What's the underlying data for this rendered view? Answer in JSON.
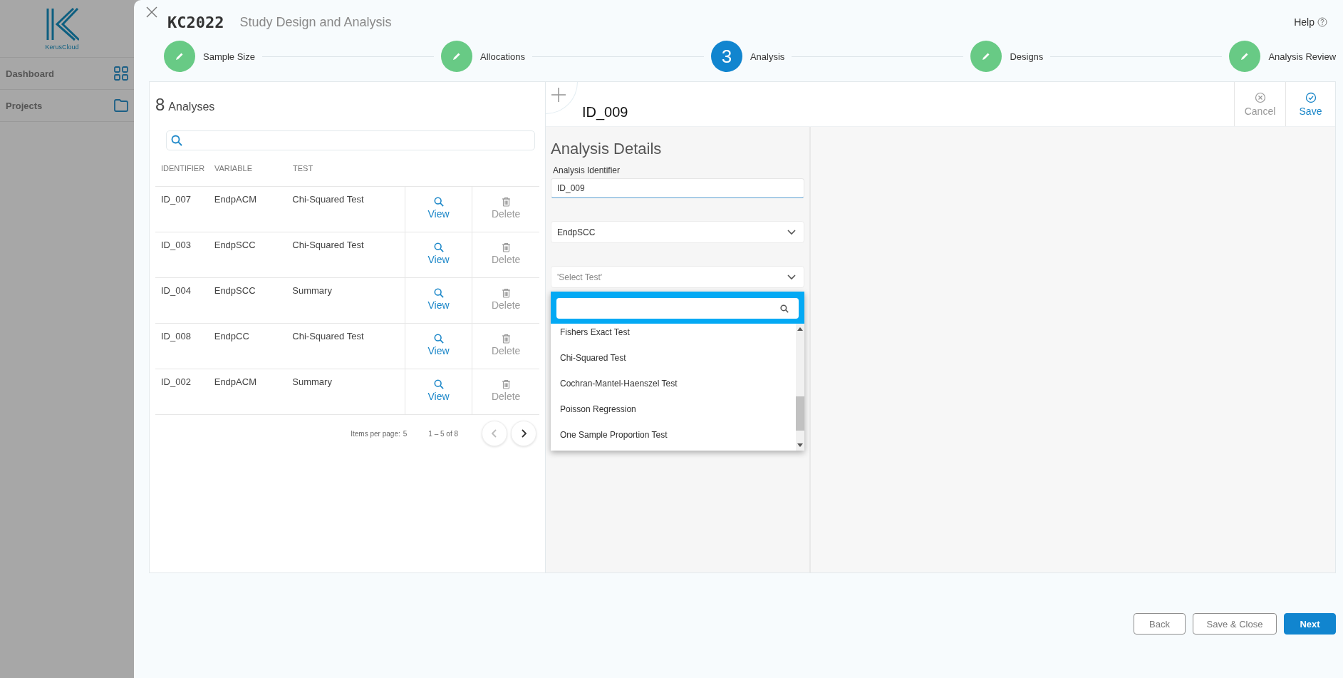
{
  "sidebar": {
    "logo_text": "KerusCloud",
    "items": [
      {
        "label": "Dashboard",
        "kind": "grid"
      },
      {
        "label": "Projects",
        "kind": "folder"
      }
    ]
  },
  "header": {
    "code": "KC2022",
    "title": "Study Design and Analysis",
    "help": "Help"
  },
  "steps": [
    {
      "label": "Sample Size",
      "completed": true
    },
    {
      "label": "Allocations",
      "completed": true
    },
    {
      "label": "Analysis",
      "completed": false,
      "number": "3"
    },
    {
      "label": "Designs",
      "completed": true
    },
    {
      "label": "Analysis Review",
      "completed": true
    }
  ],
  "analyses": {
    "count": "8",
    "title": "Analyses",
    "columns": [
      "IDENTIFIER",
      "VARIABLE",
      "TEST"
    ],
    "rows": [
      {
        "identifier": "ID_007",
        "variable": "EndpACM",
        "test": "Chi-Squared Test",
        "view": "View",
        "delete": "Delete",
        "delete_disabled": true
      },
      {
        "identifier": "ID_003",
        "variable": "EndpSCC",
        "test": "Chi-Squared Test",
        "view": "View",
        "delete": "Delete",
        "delete_disabled": true
      },
      {
        "identifier": "ID_004",
        "variable": "EndpSCC",
        "test": "Summary",
        "view": "View",
        "delete": "Delete",
        "delete_disabled": true
      },
      {
        "identifier": "ID_008",
        "variable": "EndpCC",
        "test": "Chi-Squared Test",
        "view": "View",
        "delete": "Delete",
        "delete_disabled": true
      },
      {
        "identifier": "ID_002",
        "variable": "EndpACM",
        "test": "Summary",
        "view": "View",
        "delete": "Delete",
        "delete_disabled": true
      }
    ],
    "pagination": {
      "items_per_page": "Items per page:",
      "page_size": "5",
      "range": "1 – 5 of 8",
      "prev_disabled": true,
      "next_disabled": false
    }
  },
  "editor": {
    "id": "ID_009",
    "cancel": "Cancel",
    "save": "Save",
    "section_title": "Analysis Details",
    "identifier_label": "Analysis Identifier",
    "identifier_value": "ID_009",
    "variable_value": "EndpSCC",
    "test_placeholder": "'Select Test'",
    "options": [
      "Fishers Exact Test",
      "Chi-Squared Test",
      "Cochran-Mantel-Haenszel Test",
      "Poisson Regression",
      "One Sample Proportion Test"
    ]
  },
  "footer": {
    "back": "Back",
    "save_close": "Save & Close",
    "next": "Next"
  }
}
